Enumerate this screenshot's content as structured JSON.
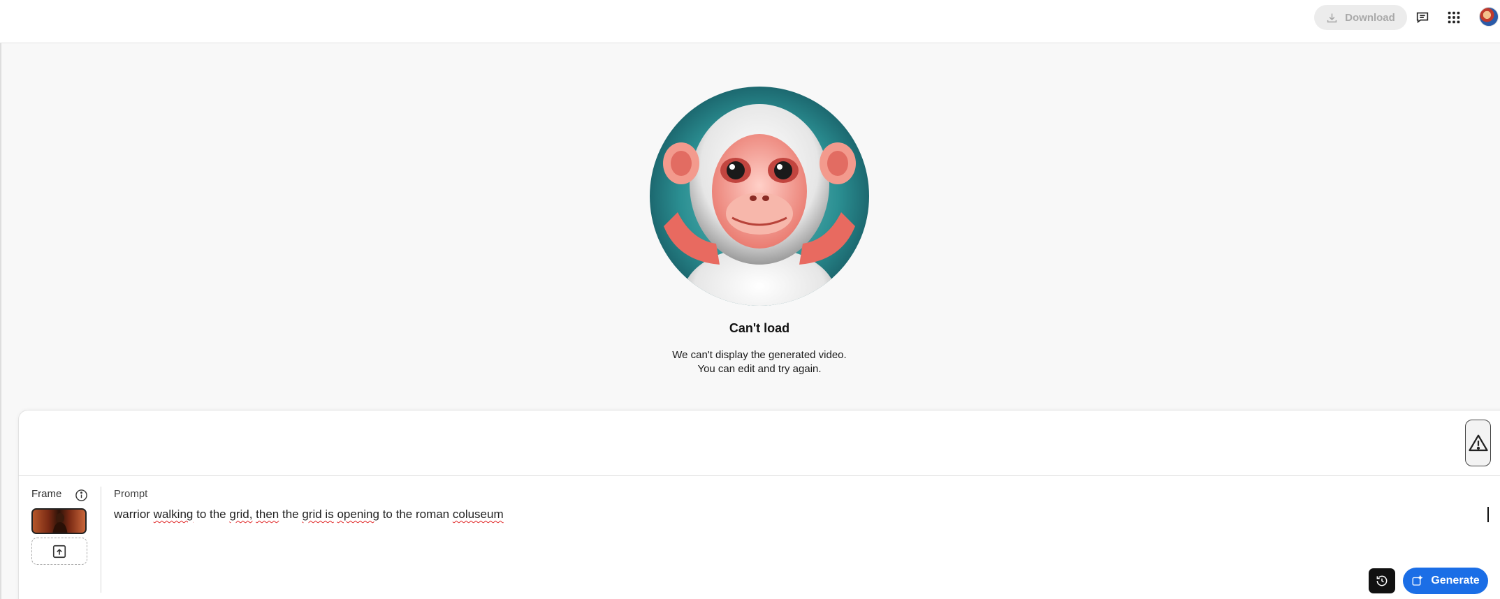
{
  "header": {
    "download_label": "Download",
    "icons": [
      "download-icon",
      "feedback-icon",
      "apps-grid-icon",
      "avatar"
    ]
  },
  "error": {
    "title": "Can't load",
    "line1": "We can't display the generated video.",
    "line2": "You can edit and try again."
  },
  "composer": {
    "frame_label": "Frame",
    "prompt_label": "Prompt",
    "prompt_words": [
      {
        "text": "warrior ",
        "misspelled": false
      },
      {
        "text": "walking",
        "misspelled": true
      },
      {
        "text": " to the ",
        "misspelled": false
      },
      {
        "text": "grid,",
        "misspelled": true
      },
      {
        "text": " ",
        "misspelled": false
      },
      {
        "text": "then",
        "misspelled": true
      },
      {
        "text": " the ",
        "misspelled": false
      },
      {
        "text": "grid is",
        "misspelled": true
      },
      {
        "text": " ",
        "misspelled": false
      },
      {
        "text": "opening",
        "misspelled": true
      },
      {
        "text": " to the roman ",
        "misspelled": false
      },
      {
        "text": "coluseum",
        "misspelled": true
      }
    ],
    "generate_label": "Generate"
  },
  "colors": {
    "accent": "#1b6ee6",
    "background": "#f8f8f8",
    "spellcheck": "#e02424"
  }
}
